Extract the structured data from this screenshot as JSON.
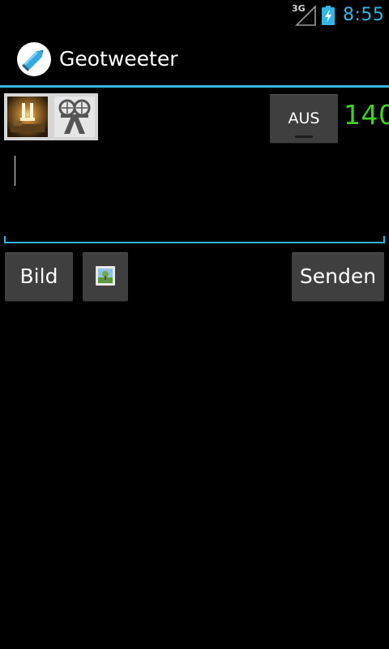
{
  "status_bar": {
    "network_type": "3G",
    "time": "8:55",
    "icons": [
      "signal-icon",
      "battery-charging-icon"
    ]
  },
  "action_bar": {
    "app_title": "Geotweeter",
    "app_icon": "pencil-app-icon"
  },
  "accounts": {
    "avatars": [
      "account-avatar-1",
      "account-avatar-2"
    ]
  },
  "toggle": {
    "label": "AUS"
  },
  "counter": {
    "remaining": "140"
  },
  "compose": {
    "text": "",
    "placeholder": ""
  },
  "buttons": {
    "bild_label": "Bild",
    "image_icon": "picture-icon",
    "senden_label": "Senden"
  },
  "colors": {
    "accent": "#33b5e5",
    "counter": "#3fd324",
    "button_bg": "#3f3f3f",
    "background": "#000000"
  }
}
